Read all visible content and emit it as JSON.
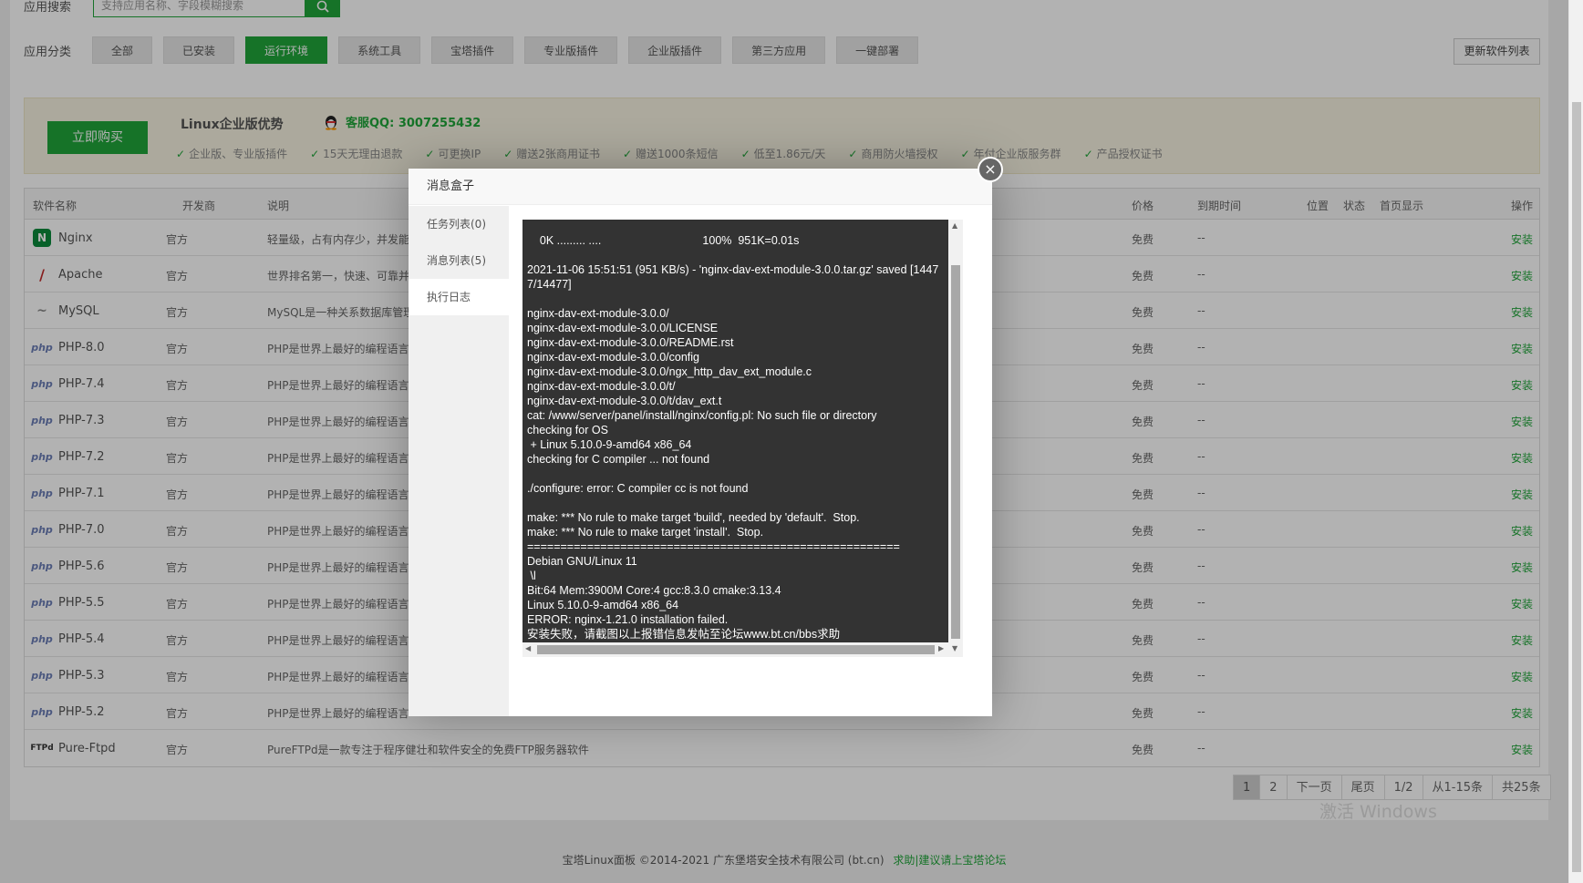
{
  "search": {
    "label": "应用搜索",
    "placeholder": "支持应用名称、字段模糊搜索"
  },
  "categories": {
    "label": "应用分类",
    "items": [
      "全部",
      "已安装",
      "运行环境",
      "系统工具",
      "宝塔插件",
      "专业版插件",
      "企业版插件",
      "第三方应用",
      "一键部署"
    ],
    "active": "运行环境"
  },
  "refresh_button": "更新软件列表",
  "promo": {
    "buy_button": "立即购买",
    "title": "Linux企业版优势",
    "qq": "客服QQ: 3007255432",
    "perks": [
      "企业版、专业版插件",
      "15天无理由退款",
      "可更换IP",
      "赠送2张商用证书",
      "赠送1000条短信",
      "低至1.86元/天",
      "商用防火墙授权",
      "年付企业版服务群",
      "产品授权证书"
    ]
  },
  "table": {
    "headers": {
      "name": "软件名称",
      "developer": "开发商",
      "description": "说明",
      "price": "价格",
      "expire": "到期时间",
      "position": "位置",
      "status": "状态",
      "home": "首页显示",
      "action": "操作"
    },
    "rows": [
      {
        "icon": "N",
        "name": "Nginx",
        "dev": "官方",
        "desc": "轻量级，占有内存少，并发能",
        "price": "免费",
        "expire": "--",
        "action": "安装"
      },
      {
        "icon": "/",
        "name": "Apache",
        "dev": "官方",
        "desc": "世界排名第一，快速、可靠并",
        "price": "免费",
        "expire": "--",
        "action": "安装"
      },
      {
        "icon": "~",
        "name": "MySQL",
        "dev": "官方",
        "desc": "MySQL是一种关系数据库管理",
        "price": "免费",
        "expire": "--",
        "action": "安装"
      },
      {
        "icon": "php",
        "name": "PHP-8.0",
        "dev": "官方",
        "desc": "PHP是世界上最好的编程语言",
        "price": "免费",
        "expire": "--",
        "action": "安装"
      },
      {
        "icon": "php",
        "name": "PHP-7.4",
        "dev": "官方",
        "desc": "PHP是世界上最好的编程语言",
        "price": "免费",
        "expire": "--",
        "action": "安装"
      },
      {
        "icon": "php",
        "name": "PHP-7.3",
        "dev": "官方",
        "desc": "PHP是世界上最好的编程语言",
        "price": "免费",
        "expire": "--",
        "action": "安装"
      },
      {
        "icon": "php",
        "name": "PHP-7.2",
        "dev": "官方",
        "desc": "PHP是世界上最好的编程语言",
        "price": "免费",
        "expire": "--",
        "action": "安装"
      },
      {
        "icon": "php",
        "name": "PHP-7.1",
        "dev": "官方",
        "desc": "PHP是世界上最好的编程语言",
        "price": "免费",
        "expire": "--",
        "action": "安装"
      },
      {
        "icon": "php",
        "name": "PHP-7.0",
        "dev": "官方",
        "desc": "PHP是世界上最好的编程语言",
        "price": "免费",
        "expire": "--",
        "action": "安装"
      },
      {
        "icon": "php",
        "name": "PHP-5.6",
        "dev": "官方",
        "desc": "PHP是世界上最好的编程语言",
        "price": "免费",
        "expire": "--",
        "action": "安装"
      },
      {
        "icon": "php",
        "name": "PHP-5.5",
        "dev": "官方",
        "desc": "PHP是世界上最好的编程语言",
        "price": "免费",
        "expire": "--",
        "action": "安装"
      },
      {
        "icon": "php",
        "name": "PHP-5.4",
        "dev": "官方",
        "desc": "PHP是世界上最好的编程语言",
        "price": "免费",
        "expire": "--",
        "action": "安装"
      },
      {
        "icon": "php",
        "name": "PHP-5.3",
        "dev": "官方",
        "desc": "PHP是世界上最好的编程语言",
        "price": "免费",
        "expire": "--",
        "action": "安装"
      },
      {
        "icon": "php",
        "name": "PHP-5.2",
        "dev": "官方",
        "desc": "PHP是世界上最好的编程语言",
        "price": "免费",
        "expire": "--",
        "action": "安装"
      },
      {
        "icon": "FTPd",
        "name": "Pure-Ftpd",
        "dev": "官方",
        "desc": "PureFTPd是一款专注于程序健壮和软件安全的免费FTP服务器软件",
        "price": "免费",
        "expire": "--",
        "action": "安装"
      }
    ]
  },
  "pager": {
    "items": [
      "1",
      "2",
      "下一页",
      "尾页",
      "1/2",
      "从1-15条",
      "共25条"
    ],
    "active": "1"
  },
  "watermark": "激活 Windows",
  "footer": {
    "copyright": "宝塔Linux面板 ©2014-2021 广东堡塔安全技术有限公司 (bt.cn)",
    "link": "求助|建议请上宝塔论坛"
  },
  "dialog": {
    "title": "消息盒子",
    "close_icon": "×",
    "tabs": [
      "任务列表(0)",
      "消息列表(5)",
      "执行日志"
    ],
    "active_tab": "执行日志",
    "log": "    0K ......... ....                                100%  951K=0.01s\n\n2021-11-06 15:51:51 (951 KB/s) - 'nginx-dav-ext-module-3.0.0.tar.gz' saved [14477/14477]\n\nnginx-dav-ext-module-3.0.0/\nnginx-dav-ext-module-3.0.0/LICENSE\nnginx-dav-ext-module-3.0.0/README.rst\nnginx-dav-ext-module-3.0.0/config\nnginx-dav-ext-module-3.0.0/ngx_http_dav_ext_module.c\nnginx-dav-ext-module-3.0.0/t/\nnginx-dav-ext-module-3.0.0/t/dav_ext.t\ncat: /www/server/panel/install/nginx/config.pl: No such file or directory\nchecking for OS\n + Linux 5.10.0-9-amd64 x86_64\nchecking for C compiler ... not found\n\n./configure: error: C compiler cc is not found\n\nmake: *** No rule to make target 'build', needed by 'default'.  Stop.\nmake: *** No rule to make target 'install'.  Stop.\n========================================================\nDebian GNU/Linux 11\n \\l\nBit:64 Mem:3900M Core:4 gcc:8.3.0 cmake:3.13.4\nLinux 5.10.0-9-amd64 x86_64\nERROR: nginx-1.21.0 installation failed.\n安装失败，请截图以上报错信息发帖至论坛www.bt.cn/bbs求助"
  },
  "colors": {
    "accent": "#20a53a",
    "console_bg": "#333333",
    "overlay": "rgba(0,0,0,0.3)"
  }
}
